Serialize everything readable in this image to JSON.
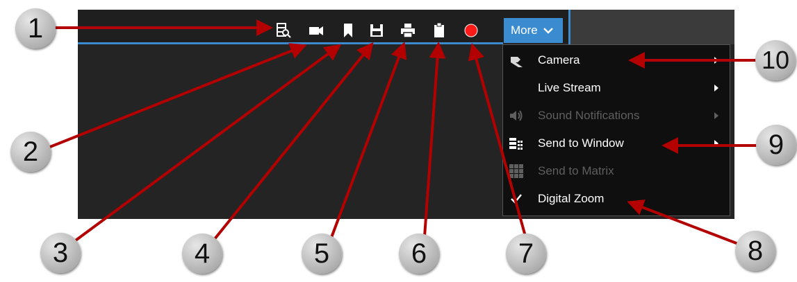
{
  "toolbar": {
    "icons": [
      "playback-icon",
      "camera-icon",
      "bookmark-icon",
      "save-icon",
      "print-icon",
      "clipboard-icon",
      "record-icon"
    ],
    "record_color": "#ff1a1a",
    "accent": "#3a8bd0"
  },
  "more_button": {
    "label": "More"
  },
  "menu": {
    "items": [
      {
        "label": "Camera",
        "icon": "camera-pin-icon",
        "has_submenu": true,
        "enabled": true
      },
      {
        "label": "Live Stream",
        "icon": "",
        "has_submenu": true,
        "enabled": true
      },
      {
        "label": "Sound Notifications",
        "icon": "speaker-icon",
        "has_submenu": true,
        "enabled": false
      },
      {
        "label": "Send to Window",
        "icon": "send-window-icon",
        "has_submenu": true,
        "enabled": true
      },
      {
        "label": "Send to Matrix",
        "icon": "matrix-icon",
        "has_submenu": false,
        "enabled": false
      },
      {
        "label": "Digital Zoom",
        "icon": "checkmark-icon",
        "has_submenu": false,
        "enabled": true,
        "checked": true
      }
    ]
  },
  "callouts": [
    "1",
    "2",
    "3",
    "4",
    "5",
    "6",
    "7",
    "8",
    "9",
    "10"
  ],
  "callout_arrow_color": "#b30000"
}
